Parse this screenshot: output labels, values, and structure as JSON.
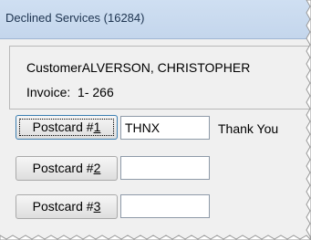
{
  "window": {
    "title": "Declined Services (16284)"
  },
  "info": {
    "customer_label": "Customer",
    "customer_name": "ALVERSON, CHRISTOPHER",
    "invoice_label": "Invoice:",
    "invoice_number": "1- 266"
  },
  "postcards": [
    {
      "label_prefix": "Postcard #",
      "label_key": "1",
      "code": "THNX",
      "description": "Thank You",
      "focused": true
    },
    {
      "label_prefix": "Postcard #",
      "label_key": "2",
      "code": "",
      "description": "",
      "focused": false
    },
    {
      "label_prefix": "Postcard #",
      "label_key": "3",
      "code": "",
      "description": "",
      "focused": false
    }
  ]
}
